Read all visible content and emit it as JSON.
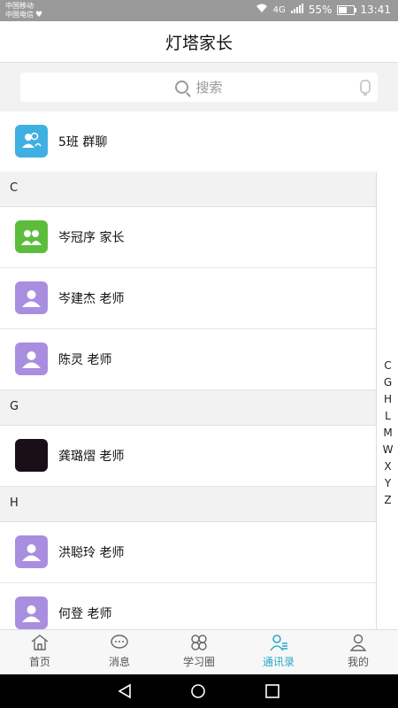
{
  "status": {
    "carrier1": "中国移动",
    "carrier2": "中国电信",
    "network": "4G",
    "battery": "55%",
    "time": "13:41"
  },
  "header": {
    "title": "灯塔家长"
  },
  "search": {
    "placeholder": "搜索"
  },
  "group_chat": {
    "label": "5班 群聊",
    "color": "#3fb0e2"
  },
  "sections": [
    {
      "letter": "C",
      "contacts": [
        {
          "name": "岑冠序 家长",
          "avatar_color": "#5cbd3c",
          "icon": "parents-icon"
        },
        {
          "name": "岑建杰 老师",
          "avatar_color": "#a98ee0",
          "icon": "teacher-icon"
        },
        {
          "name": "陈灵 老师",
          "avatar_color": "#a98ee0",
          "icon": "teacher-icon"
        }
      ]
    },
    {
      "letter": "G",
      "contacts": [
        {
          "name": "龚璐熠 老师",
          "avatar_color": "#1a0f16",
          "icon": "photo-avatar"
        }
      ]
    },
    {
      "letter": "H",
      "contacts": [
        {
          "name": "洪聪玲 老师",
          "avatar_color": "#a98ee0",
          "icon": "teacher-icon"
        },
        {
          "name": "何登 老师",
          "avatar_color": "#a98ee0",
          "icon": "teacher-icon"
        }
      ]
    }
  ],
  "index_letters": [
    "C",
    "G",
    "H",
    "L",
    "M",
    "W",
    "X",
    "Y",
    "Z"
  ],
  "tabs": [
    {
      "label": "首页",
      "icon": "home-icon",
      "active": false
    },
    {
      "label": "消息",
      "icon": "message-icon",
      "active": false
    },
    {
      "label": "学习圈",
      "icon": "study-circle-icon",
      "active": false
    },
    {
      "label": "通讯录",
      "icon": "contacts-icon",
      "active": true
    },
    {
      "label": "我的",
      "icon": "profile-icon",
      "active": false
    }
  ],
  "colors": {
    "accent": "#29a9c7",
    "teacher": "#a98ee0",
    "parent": "#5cbd3c",
    "group": "#3fb0e2"
  }
}
